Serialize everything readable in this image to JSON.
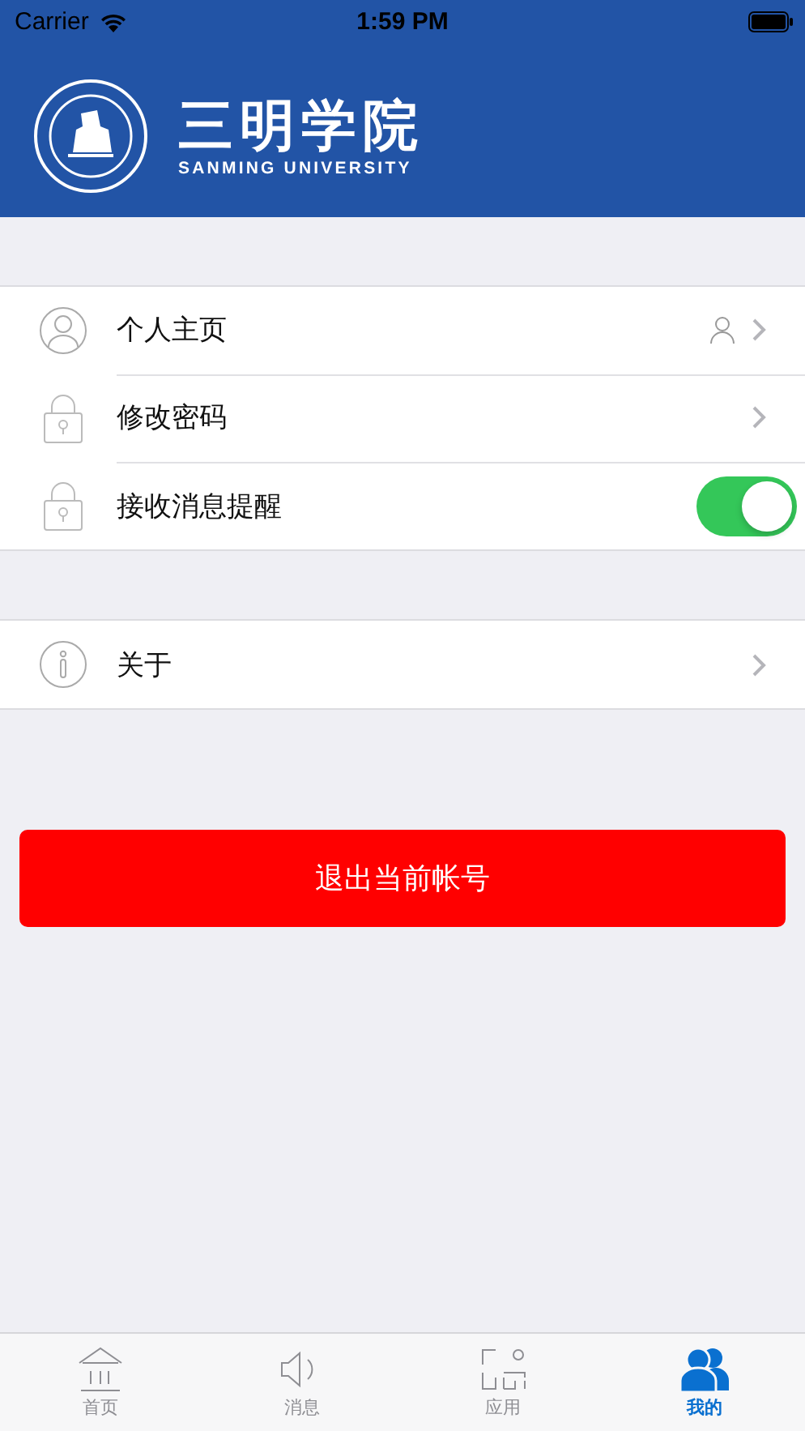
{
  "status_bar": {
    "carrier": "Carrier",
    "time": "1:59 PM"
  },
  "header": {
    "title": "三明学院",
    "subtitle": "SANMING UNIVERSITY"
  },
  "sections": [
    {
      "rows": [
        {
          "kind": "profile",
          "label": "个人主页"
        },
        {
          "kind": "password",
          "label": "修改密码"
        },
        {
          "kind": "toggle",
          "label": "接收消息提醒",
          "on": true
        }
      ]
    },
    {
      "rows": [
        {
          "kind": "about",
          "label": "关于"
        }
      ]
    }
  ],
  "logout_button": "退出当前帐号",
  "tabs": [
    {
      "label": "首页",
      "selected": false
    },
    {
      "label": "消息",
      "selected": false
    },
    {
      "label": "应用",
      "selected": false
    },
    {
      "label": "我的",
      "selected": true
    }
  ]
}
